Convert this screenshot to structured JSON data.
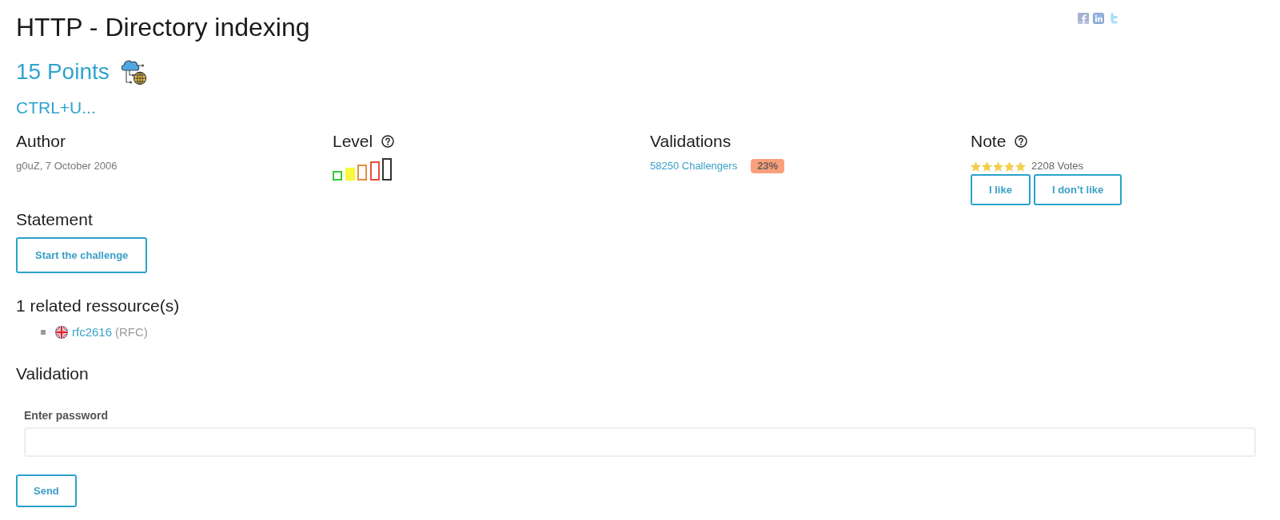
{
  "header": {
    "title": "HTTP - Directory indexing",
    "points": "15 Points",
    "hint": "CTRL+U..."
  },
  "info": {
    "author": {
      "heading": "Author",
      "text": "g0uZ, 7 October 2006"
    },
    "level": {
      "heading": "Level",
      "bars": [
        {
          "color": "#33cc33",
          "selected": false
        },
        {
          "color": "#f8f83c",
          "selected": true
        },
        {
          "color": "#e58f3c",
          "selected": false
        },
        {
          "color": "#e4503a",
          "selected": false
        },
        {
          "color": "#333333",
          "selected": false
        }
      ]
    },
    "validations": {
      "heading": "Validations",
      "challengers": "58250 Challengers",
      "rate": "23%"
    },
    "note": {
      "heading": "Note",
      "stars": 5,
      "votes": "2208 Votes",
      "buttons": [
        "I like",
        "I don’t like"
      ]
    }
  },
  "statement": {
    "heading": "Statement",
    "button": "Start the challenge"
  },
  "resources": {
    "heading": "1 related ressource(s)",
    "items": [
      {
        "link": "rfc2616",
        "type": "(RFC)"
      }
    ]
  },
  "validation": {
    "heading": "Validation",
    "field_label": "Enter password",
    "button": "Send"
  }
}
